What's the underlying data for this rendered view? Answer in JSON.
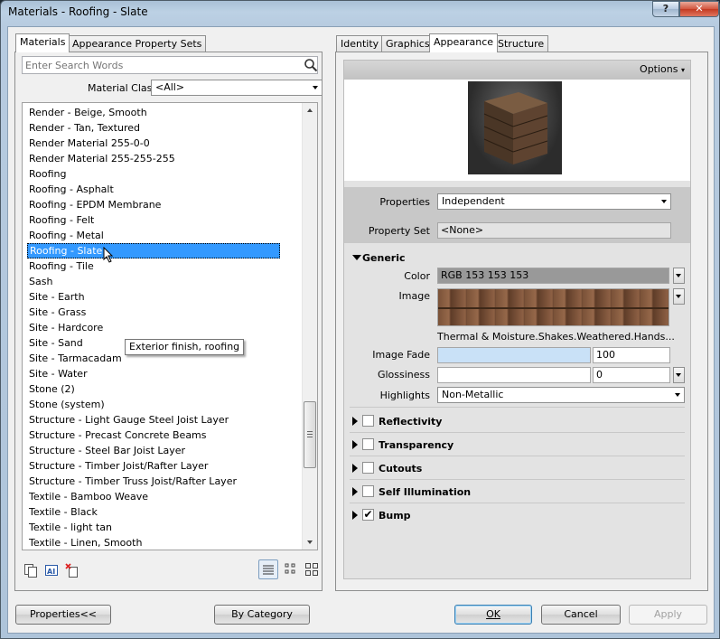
{
  "window": {
    "title": "Materials - Roofing - Slate",
    "help_label": "?",
    "close_label": "✕"
  },
  "left_tabs": [
    {
      "label": "Materials",
      "active": true
    },
    {
      "label": "Appearance Property Sets",
      "active": false
    }
  ],
  "search": {
    "placeholder": "Enter Search Words",
    "value": ""
  },
  "material_class": {
    "label": "Material Class:",
    "value": "<All>"
  },
  "material_list": {
    "items": [
      "Render - Beige, Smooth",
      "Render - Tan, Textured",
      "Render Material 255-0-0",
      "Render Material 255-255-255",
      "Roofing",
      "Roofing - Asphalt",
      "Roofing - EPDM Membrane",
      "Roofing - Felt",
      "Roofing - Metal",
      "Roofing - Slate",
      "Roofing - Tile",
      "Sash",
      "Site - Earth",
      "Site - Grass",
      "Site - Hardcore",
      "Site - Sand",
      "Site - Tarmacadam",
      "Site - Water",
      "Stone (2)",
      "Stone (system)",
      "Structure - Light Gauge Steel Joist Layer",
      "Structure - Precast Concrete Beams",
      "Structure - Steel Bar Joist Layer",
      "Structure - Timber Joist/Rafter Layer",
      "Structure - Timber Truss Joist/Rafter Layer",
      "Textile - Bamboo Weave",
      "Textile - Black",
      "Textile - light tan",
      "Textile - Linen, Smooth"
    ],
    "selected": "Roofing - Slate",
    "tooltip": "Exterior finish, roofing"
  },
  "right_tabs": [
    {
      "label": "Identity",
      "active": false
    },
    {
      "label": "Graphics",
      "active": false
    },
    {
      "label": "Appearance",
      "active": true
    },
    {
      "label": "Structure",
      "active": false
    }
  ],
  "appearance": {
    "options_label": "Options",
    "properties_label": "Properties",
    "properties_value": "Independent",
    "property_set_label": "Property Set",
    "property_set_value": "<None>",
    "generic": {
      "title": "Generic",
      "color_label": "Color",
      "color_value": "RGB 153 153 153",
      "image_label": "Image",
      "image_name": "Thermal & Moisture.Shakes.Weathered.Hands...",
      "image_fade_label": "Image Fade",
      "image_fade_value": "100",
      "image_fade_fraction": 1.0,
      "glossiness_label": "Glossiness",
      "glossiness_value": "0",
      "highlights_label": "Highlights",
      "highlights_value": "Non-Metallic"
    },
    "sections": [
      {
        "title": "Reflectivity",
        "checked": false
      },
      {
        "title": "Transparency",
        "checked": false
      },
      {
        "title": "Cutouts",
        "checked": false
      },
      {
        "title": "Self Illumination",
        "checked": false
      },
      {
        "title": "Bump",
        "checked": true
      }
    ]
  },
  "buttons": {
    "properties": "Properties<<",
    "by_category": "By Category",
    "ok": "OK",
    "cancel": "Cancel",
    "apply": "Apply"
  },
  "colors": {
    "selection": "#3399ff",
    "color_swatch": "#999999",
    "image_fade_bar": "#c9e1f7",
    "panel_gray": "#d9d9d9"
  }
}
